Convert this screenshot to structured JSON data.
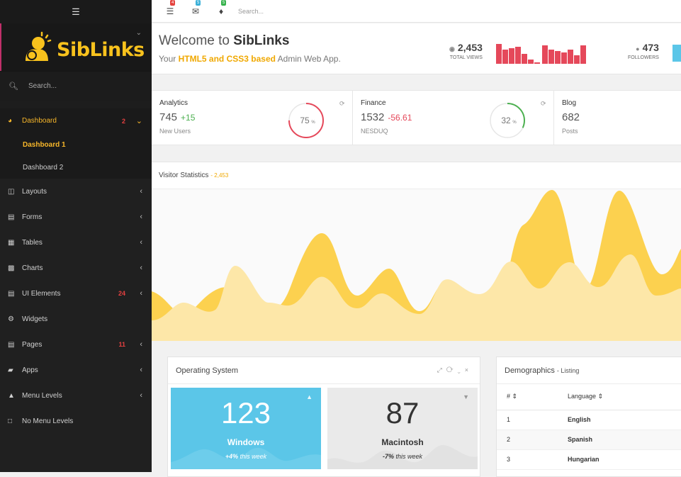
{
  "app": {
    "brand": "SibLinks"
  },
  "topbar": {
    "badges": [
      {
        "icon": "tasks-icon",
        "count": "4",
        "color": "#e5433f"
      },
      {
        "icon": "envelope-icon",
        "count": "5",
        "color": "#3bb0d8"
      },
      {
        "icon": "bell-icon",
        "count": "5",
        "color": "#37b24d"
      }
    ],
    "search_placeholder": "Search..."
  },
  "sidebar": {
    "search_placeholder": "Search...",
    "items": [
      {
        "label": "Dashboard",
        "icon": "dashboard-icon",
        "count": "2",
        "active": true
      },
      {
        "label": "Layouts",
        "icon": "layouts-icon"
      },
      {
        "label": "Forms",
        "icon": "forms-icon"
      },
      {
        "label": "Tables",
        "icon": "tables-icon"
      },
      {
        "label": "Charts",
        "icon": "charts-icon"
      },
      {
        "label": "UI Elements",
        "icon": "ui-elements-icon",
        "count": "24"
      },
      {
        "label": "Widgets",
        "icon": "widgets-icon"
      },
      {
        "label": "Pages",
        "icon": "pages-icon",
        "count": "11"
      },
      {
        "label": "Apps",
        "icon": "apps-icon"
      },
      {
        "label": "Menu Levels",
        "icon": "sitemap-icon"
      },
      {
        "label": "No Menu Levels",
        "icon": "file-icon"
      }
    ],
    "sub_items": [
      {
        "label": "Dashboard 1",
        "active": true
      },
      {
        "label": "Dashboard 2"
      }
    ]
  },
  "welcome": {
    "title_prefix": "Welcome to ",
    "title_brand": "SibLinks",
    "sub_prefix": "Your ",
    "sub_highlight": "HTML5 and CSS3 based",
    "sub_suffix": " Admin Web App.",
    "views_value": "2,453",
    "views_label": "TOTAL VIEWS",
    "followers_value": "473",
    "followers_label": "FOLLOWERS"
  },
  "cards": {
    "analytics": {
      "title": "Analytics",
      "value": "745",
      "delta": "+15",
      "sub": "New Users",
      "percent": "75",
      "unit": "%"
    },
    "finance": {
      "title": "Finance",
      "value": "1532",
      "delta": "-56.61",
      "sub": "NESDUQ",
      "percent": "32",
      "unit": "%"
    },
    "blog": {
      "title": "Blog",
      "value": "682",
      "sub": "Posts"
    }
  },
  "visitor": {
    "title": "Visitor Statistics",
    "subtitle": "- 2,453"
  },
  "os": {
    "title": "Operating System",
    "windows": {
      "value": "123",
      "name": "Windows",
      "change_pct": "+4%",
      "change_text": " this week"
    },
    "mac": {
      "value": "87",
      "name": "Macintosh",
      "change_pct": "-7%",
      "change_text": " this week"
    }
  },
  "demographics": {
    "title": "Demographics",
    "subtitle": "- Listing",
    "columns": [
      "#",
      "Language"
    ],
    "rows": [
      {
        "n": "1",
        "lang": "English"
      },
      {
        "n": "2",
        "lang": "Spanish"
      },
      {
        "n": "3",
        "lang": "Hungarian"
      }
    ]
  },
  "colors": {
    "accent": "#f8c21d",
    "windows_bg": "#5bc6e8",
    "mac_bg": "#eaeaea",
    "bars": "#e5485a"
  }
}
